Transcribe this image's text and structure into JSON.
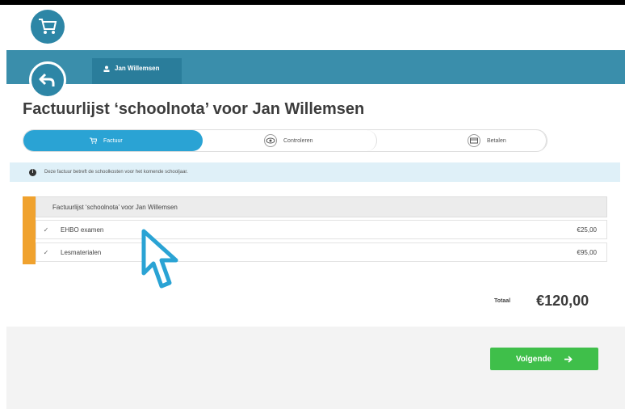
{
  "header": {
    "cart_icon": "cart-icon",
    "back_icon": "back-arrow-icon",
    "user_tab": {
      "icon": "user-icon",
      "label": "Jan Willemsen"
    }
  },
  "page": {
    "title": "Factuurlijst ‘schoolnota’ voor Jan Willemsen"
  },
  "steps": [
    {
      "label": "Factuur",
      "icon": "cart-icon",
      "active": true
    },
    {
      "label": "Controleren",
      "icon": "eye-icon",
      "active": false
    },
    {
      "label": "Betalen",
      "icon": "credit-card-icon",
      "active": false
    }
  ],
  "info": {
    "icon": "info-icon",
    "text": "Deze factuur betreft de schoolkosten voor het komende schooljaar."
  },
  "invoice": {
    "heading": "Factuurlijst ‘schoolnota’ voor Jan Willemsen",
    "items": [
      {
        "check": "✓",
        "name": "EHBO examen",
        "price": "€25,00"
      },
      {
        "check": "✓",
        "name": "Lesmaterialen",
        "price": "€95,00"
      }
    ],
    "total_label": "Totaal",
    "total_value": "€120,00"
  },
  "actions": {
    "next_label": "Volgende",
    "next_icon": "arrow-right-icon"
  },
  "colors": {
    "accent_blue": "#2aa3d4",
    "band_blue": "#3a8eab",
    "orange": "#f0a22e",
    "green": "#3fbf4a"
  }
}
